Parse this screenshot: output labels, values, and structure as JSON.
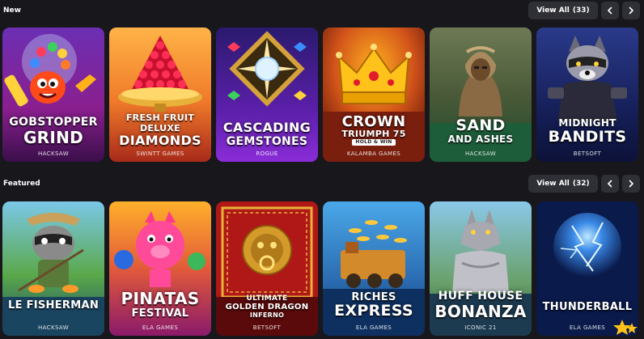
{
  "sections": [
    {
      "title": "New",
      "view_all_label": "View All",
      "view_all_count": "(33)",
      "games": [
        {
          "title_lines": [
            "GOBSTOPPER",
            "GRIND"
          ],
          "provider": "HACKSAW"
        },
        {
          "title_lines": [
            "FRESH FRUIT",
            "DELUXE",
            "DIAMONDS"
          ],
          "provider": "SWINTT GAMES"
        },
        {
          "title_lines": [
            "CASCADING",
            "GEMSTONES"
          ],
          "provider": "ROGUE"
        },
        {
          "title_lines": [
            "CROWN",
            "TRIUMPH 75"
          ],
          "tag": "HOLD & WIN",
          "provider": "KALAMBA GAMES"
        },
        {
          "title_lines": [
            "SAND",
            "AND ASHES"
          ],
          "provider": "HACKSAW"
        },
        {
          "title_lines": [
            "MIDNIGHT",
            "BANDITS"
          ],
          "provider": "BETSOFT"
        }
      ]
    },
    {
      "title": "Featured",
      "view_all_label": "View All",
      "view_all_count": "(32)",
      "games": [
        {
          "title_lines": [
            "LE FISHERMAN"
          ],
          "provider": "HACKSAW"
        },
        {
          "title_lines": [
            "PINATAS",
            "FESTIVAL"
          ],
          "provider": "ELA GAMES"
        },
        {
          "title_lines": [
            "ULTIMATE",
            "GOLDEN DRAGON",
            "INFERNO"
          ],
          "provider": "BETSOFT"
        },
        {
          "title_lines": [
            "RICHES",
            "EXPRESS"
          ],
          "provider": "ELA GAMES"
        },
        {
          "title_lines": [
            "HUFF HOUSE",
            "BONANZA"
          ],
          "provider": "ICONIC 21"
        },
        {
          "title_lines": [
            "THUNDERBALL"
          ],
          "provider": "ELA GAMES"
        }
      ]
    }
  ],
  "icons": {
    "prev": "chevron-left-icon",
    "next": "chevron-right-icon"
  },
  "colors": {
    "background": "#17171c",
    "button": "#2f2f36",
    "text": "#ffffff"
  }
}
